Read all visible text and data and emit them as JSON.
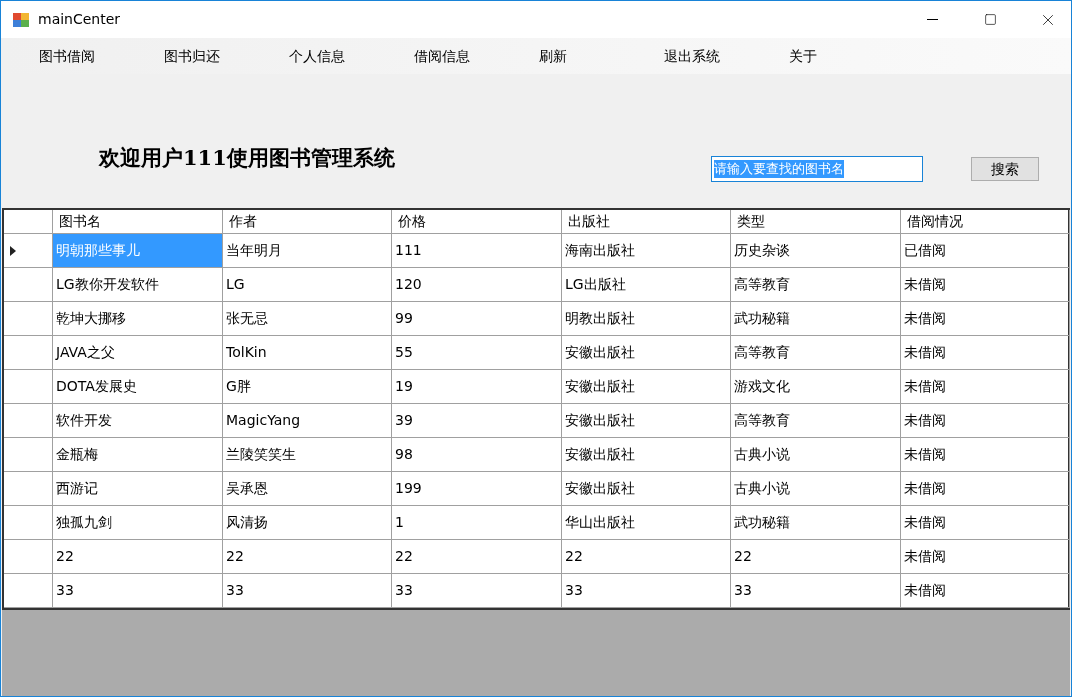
{
  "window": {
    "title": "mainCenter"
  },
  "menu": [
    "图书借阅",
    "图书归还",
    "个人信息",
    "借阅信息",
    "刷新",
    "退出系统",
    "关于"
  ],
  "welcome": "欢迎用户111使用图书管理系统",
  "search": {
    "value": "请输入要查找的图书名",
    "button": "搜索"
  },
  "table": {
    "columns": [
      "图书名",
      "作者",
      "价格",
      "出版社",
      "类型",
      "借阅情况"
    ],
    "rows": [
      {
        "selected": true,
        "cells": [
          "明朝那些事儿",
          "当年明月",
          "111",
          "海南出版社",
          "历史杂谈",
          "已借阅"
        ]
      },
      {
        "selected": false,
        "cells": [
          "LG教你开发软件",
          "LG",
          "120",
          "LG出版社",
          "高等教育",
          "未借阅"
        ]
      },
      {
        "selected": false,
        "cells": [
          "乾坤大挪移",
          "张无忌",
          "99",
          "明教出版社",
          "武功秘籍",
          "未借阅"
        ]
      },
      {
        "selected": false,
        "cells": [
          "JAVA之父",
          "TolKin",
          "55",
          "安徽出版社",
          "高等教育",
          "未借阅"
        ]
      },
      {
        "selected": false,
        "cells": [
          "DOTA发展史",
          "G胖",
          "19",
          "安徽出版社",
          "游戏文化",
          "未借阅"
        ]
      },
      {
        "selected": false,
        "cells": [
          "软件开发",
          "MagicYang",
          "39",
          "安徽出版社",
          "高等教育",
          "未借阅"
        ]
      },
      {
        "selected": false,
        "cells": [
          "金瓶梅",
          "兰陵笑笑生",
          "98",
          "安徽出版社",
          "古典小说",
          "未借阅"
        ]
      },
      {
        "selected": false,
        "cells": [
          "西游记",
          "吴承恩",
          "199",
          "安徽出版社",
          "古典小说",
          "未借阅"
        ]
      },
      {
        "selected": false,
        "cells": [
          "独孤九剑",
          "风清扬",
          "1",
          "华山出版社",
          "武功秘籍",
          "未借阅"
        ]
      },
      {
        "selected": false,
        "cells": [
          "22",
          "22",
          "22",
          "22",
          "22",
          "未借阅"
        ]
      },
      {
        "selected": false,
        "cells": [
          "33",
          "33",
          "33",
          "33",
          "33",
          "未借阅"
        ]
      }
    ]
  }
}
